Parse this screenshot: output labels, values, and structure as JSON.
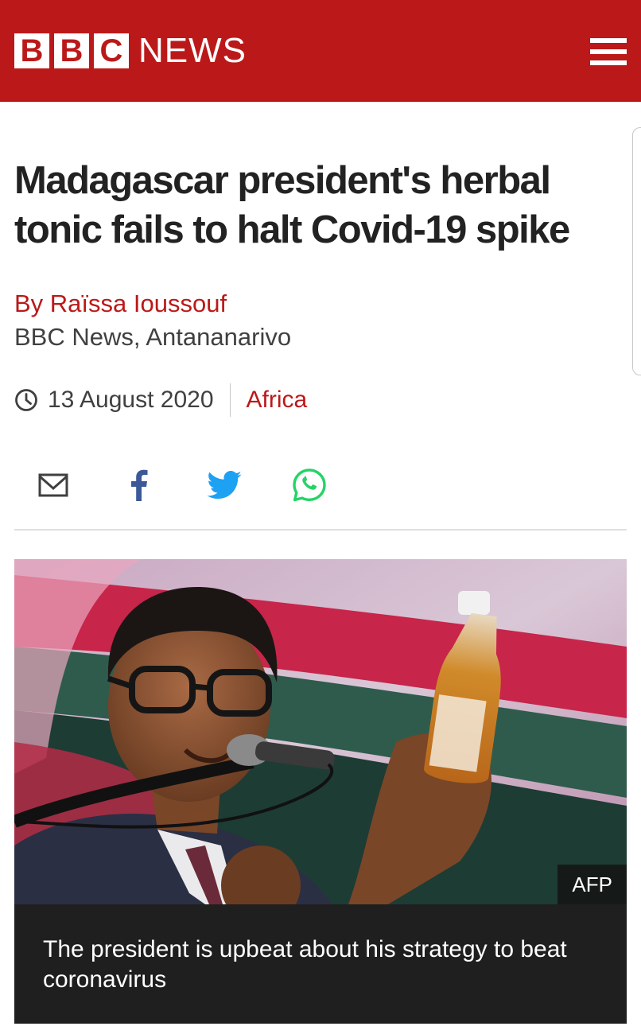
{
  "header": {
    "logo_letters": [
      "B",
      "B",
      "C"
    ],
    "logo_news": "NEWS",
    "menu_icon": "hamburger-menu-icon",
    "brand_color": "#bb1919"
  },
  "article": {
    "headline": "Madagascar president's herbal tonic fails to halt Covid-19 spike",
    "byline": "By Raïssa Ioussouf",
    "bureau": "BBC News, Antananarivo",
    "date": "13 August 2020",
    "section": "Africa"
  },
  "share": {
    "icons": [
      "email-icon",
      "facebook-icon",
      "twitter-icon",
      "whatsapp-icon"
    ],
    "colors": {
      "facebook": "#3b5998",
      "twitter": "#1da1f2",
      "whatsapp": "#25d366",
      "email": "#404040"
    }
  },
  "image": {
    "credit": "AFP",
    "caption": "The president is upbeat about his strategy to beat coronavirus"
  }
}
